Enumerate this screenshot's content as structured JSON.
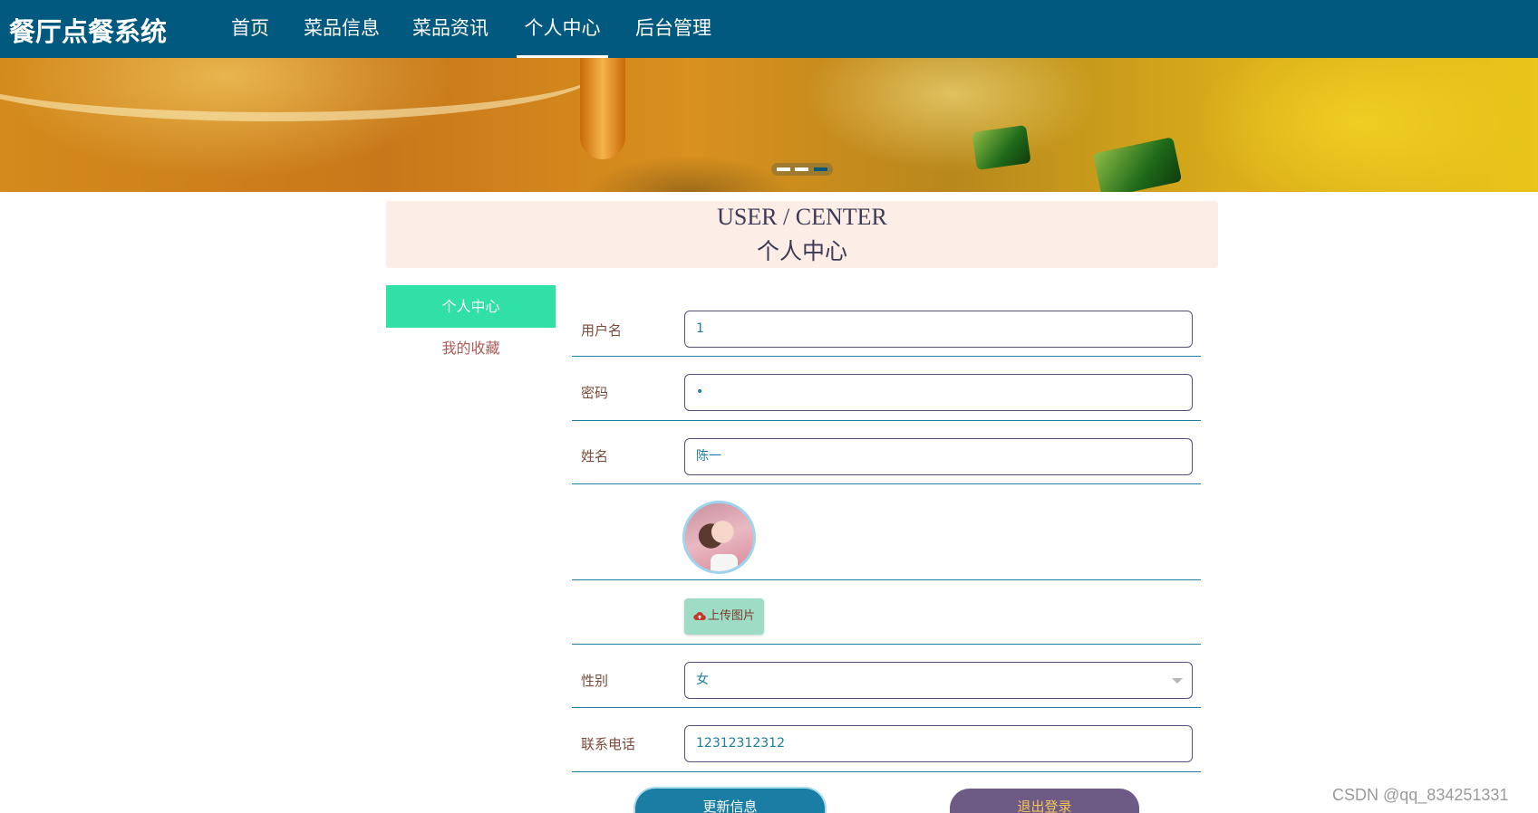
{
  "header": {
    "brand": "餐厅点餐系统",
    "nav": [
      {
        "label": "首页",
        "active": false
      },
      {
        "label": "菜品信息",
        "active": false
      },
      {
        "label": "菜品资讯",
        "active": false
      },
      {
        "label": "个人中心",
        "active": true
      },
      {
        "label": "后台管理",
        "active": false
      }
    ]
  },
  "banner": {
    "dots": 3,
    "active_dot": 3
  },
  "section": {
    "title_en": "USER / CENTER",
    "title_cn": "个人中心"
  },
  "sidebar": {
    "items": [
      {
        "label": "个人中心",
        "active": true
      },
      {
        "label": "我的收藏",
        "active": false
      }
    ]
  },
  "form": {
    "username_label": "用户名",
    "username_value": "1",
    "password_label": "密码",
    "password_value": "•",
    "name_label": "姓名",
    "name_value": "陈一",
    "upload_label": "上传图片",
    "upload_icon": "cloud-upload-icon",
    "gender_label": "性别",
    "gender_value": "女",
    "phone_label": "联系电话",
    "phone_value": "12312312312"
  },
  "actions": {
    "update_label": "更新信息",
    "logout_label": "退出登录"
  },
  "watermark": "CSDN @qq_834251331",
  "colors": {
    "nav_bg": "#01597f",
    "accent_green": "#30e0a6",
    "update_btn": "#1a7ea4",
    "logout_btn": "#6e5b85",
    "section_bg": "#fcede6"
  }
}
